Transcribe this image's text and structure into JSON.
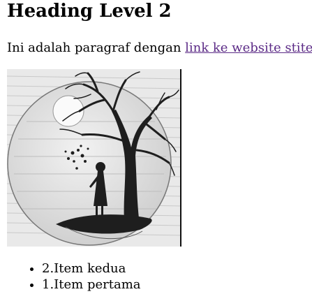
{
  "heading": "Heading Level 2",
  "paragraph": {
    "text": "Ini adalah paragraf dengan ",
    "link_text": "link ke website stitek",
    "link_color": "#5b2a86"
  },
  "image": {
    "subject": "pencil-sketch-tree-girl-moon"
  },
  "list": {
    "items": [
      "2.Item kedua",
      "1.Item pertama"
    ]
  }
}
